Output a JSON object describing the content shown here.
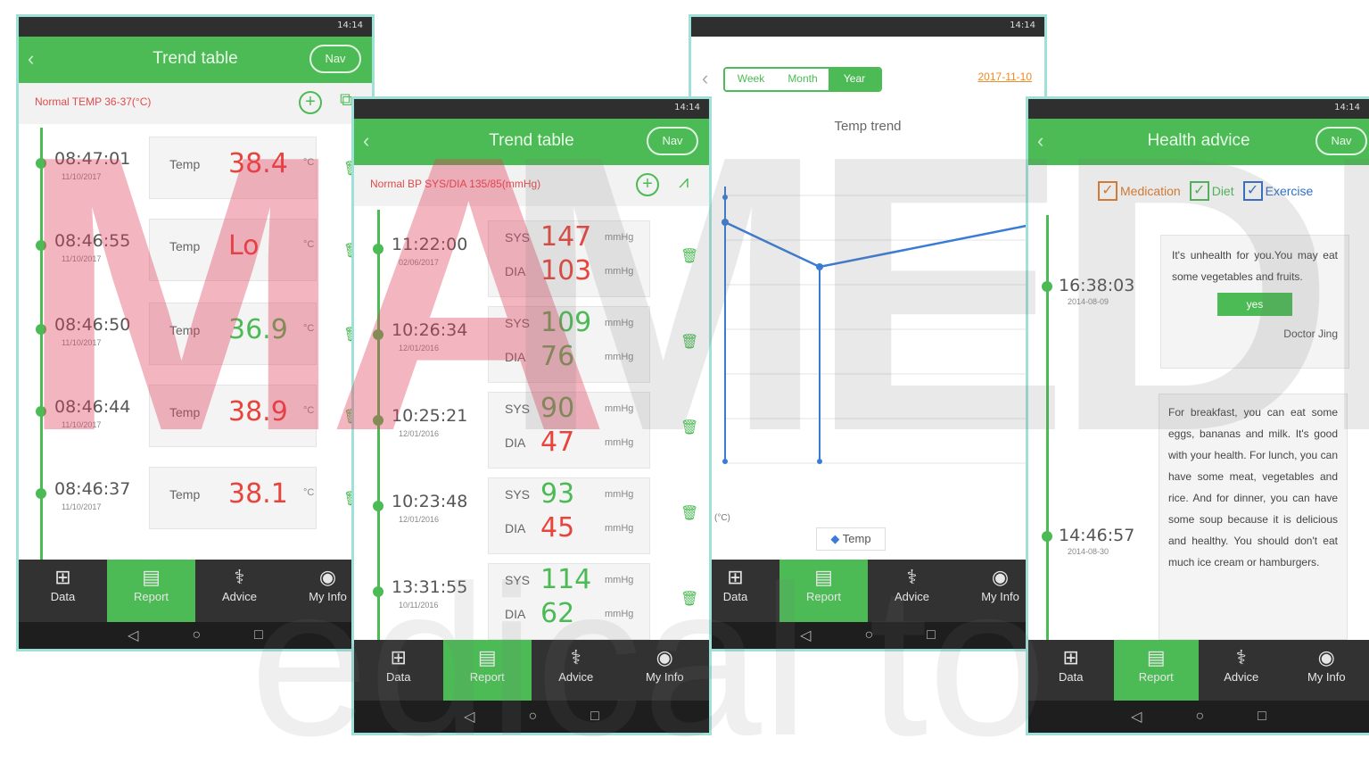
{
  "status_time": "14:14",
  "screen1": {
    "back": "‹",
    "title": "Trend table",
    "nav": "Nav",
    "normal": "Normal TEMP 36-37(°C)",
    "records": [
      {
        "time": "08:47:01",
        "date": "11/10/2017",
        "label": "Temp",
        "value": "38.4",
        "unit": "°C",
        "color": "red"
      },
      {
        "time": "08:46:55",
        "date": "11/10/2017",
        "label": "Temp",
        "value": "Lo",
        "unit": "°C",
        "color": "red"
      },
      {
        "time": "08:46:50",
        "date": "11/10/2017",
        "label": "Temp",
        "value": "36.9",
        "unit": "°C",
        "color": "green"
      },
      {
        "time": "08:46:44",
        "date": "11/10/2017",
        "label": "Temp",
        "value": "38.9",
        "unit": "°C",
        "color": "red"
      },
      {
        "time": "08:46:37",
        "date": "11/10/2017",
        "label": "Temp",
        "value": "38.1",
        "unit": "°C",
        "color": "red"
      }
    ]
  },
  "screen2": {
    "back": "‹",
    "title": "Trend table",
    "nav": "Nav",
    "normal": "Normal BP SYS/DIA 135/85(mmHg)",
    "records": [
      {
        "time": "11:22:00",
        "date": "02/06/2017",
        "sys": "147",
        "dia": "103",
        "sys_color": "red",
        "dia_color": "red"
      },
      {
        "time": "10:26:34",
        "date": "12/01/2016",
        "sys": "109",
        "dia": "76",
        "sys_color": "green",
        "dia_color": "green"
      },
      {
        "time": "10:25:21",
        "date": "12/01/2016",
        "sys": "90",
        "dia": "47",
        "sys_color": "green",
        "dia_color": "red"
      },
      {
        "time": "10:23:48",
        "date": "12/01/2016",
        "sys": "93",
        "dia": "45",
        "sys_color": "green",
        "dia_color": "red"
      },
      {
        "time": "13:31:55",
        "date": "10/11/2016",
        "sys": "114",
        "dia": "62",
        "sys_color": "green",
        "dia_color": "green"
      }
    ],
    "sys_label": "SYS",
    "dia_label": "DIA",
    "unit": "mmHg"
  },
  "screen3": {
    "back": "‹",
    "segments": [
      "Week",
      "Month",
      "Year"
    ],
    "active_segment": "Year",
    "date_link": "2017-11-10",
    "chart_title": "Temp trend",
    "legend": "Temp",
    "y_axis_label": "(°C)"
  },
  "chart_data": {
    "type": "line",
    "title": "Temp trend",
    "series": [
      {
        "name": "Temp",
        "values": [
          37.6,
          36.8,
          37.6
        ]
      }
    ],
    "grid": true,
    "legend": "bottom"
  },
  "screen4": {
    "back": "‹",
    "title": "Health advice",
    "nav": "Nav",
    "checks": [
      {
        "label": "Medication",
        "color": "#e07b2a"
      },
      {
        "label": "Diet",
        "color": "#4cbb55"
      },
      {
        "label": "Exercise",
        "color": "#2f6fc9"
      }
    ],
    "entries": [
      {
        "time": "16:38:03",
        "date": "2014-08-09",
        "text": "It's unhealth for you.You may eat some vegetables and fruits.",
        "button": "yes",
        "doctor": "Doctor Jing"
      },
      {
        "time": "14:46:57",
        "date": "2014-08-30",
        "text": "For breakfast, you can eat some eggs, bananas and milk. It's good with your health. For lunch, you can have some meat, vegetables and rice. And for dinner, you can have some soup because it is delicious and healthy. You should don't eat much ice cream or hamburgers."
      }
    ]
  },
  "tabs": [
    "Data",
    "Report",
    "Advice",
    "My Info"
  ],
  "active_tab": "Report",
  "nav_keys": [
    "◁",
    "○",
    "□"
  ],
  "watermark": "MAIMEDICAL"
}
